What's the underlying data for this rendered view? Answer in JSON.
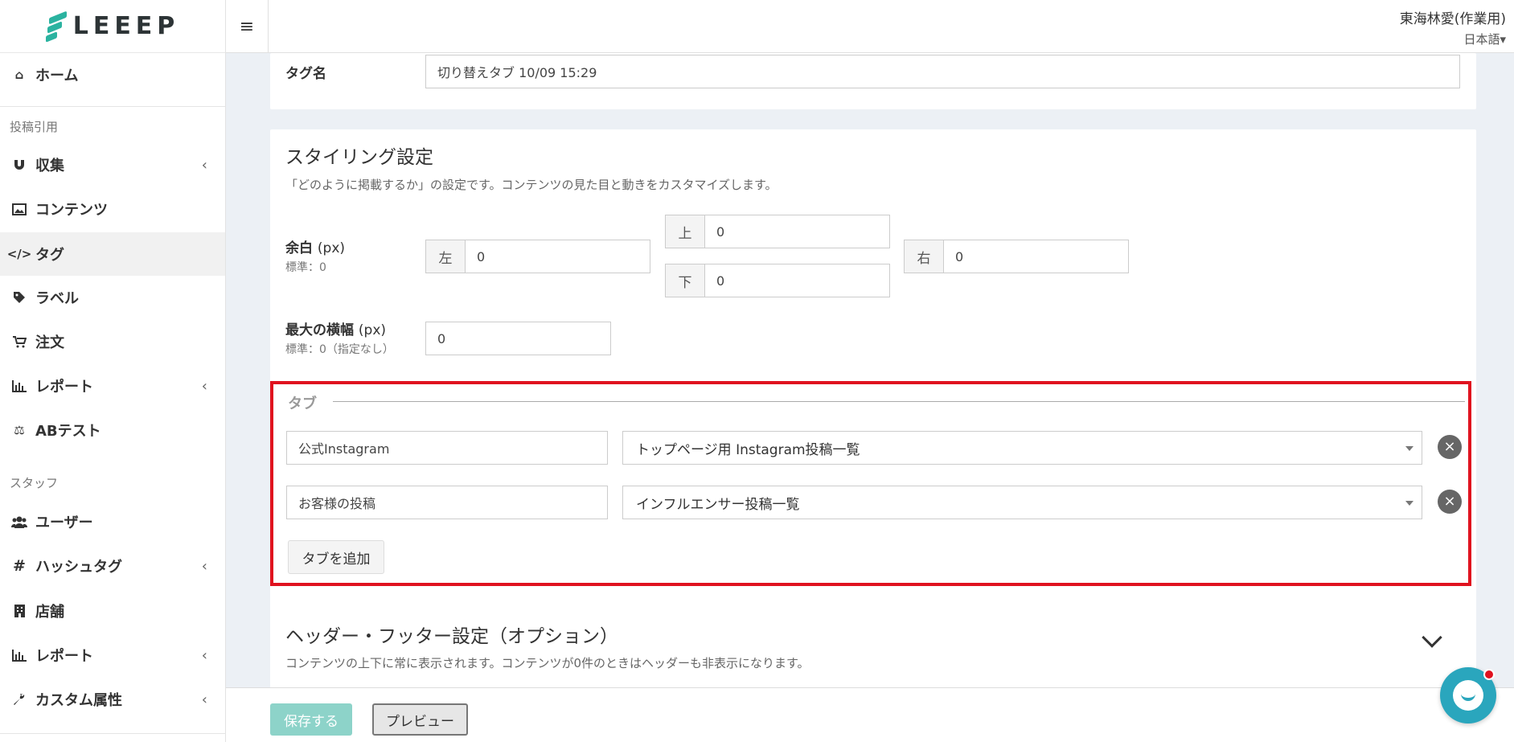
{
  "brand": {
    "name": "LEEEP"
  },
  "header": {
    "user_name": "東海林愛(作業用)",
    "language": "日本語▾"
  },
  "sidebar": {
    "items": [
      {
        "label": "ホーム",
        "icon": "home-icon"
      },
      {
        "label": "収集",
        "icon": "magnet-icon",
        "chevron": "‹"
      },
      {
        "label": "コンテンツ",
        "icon": "image-icon"
      },
      {
        "label": "タグ",
        "icon": "code-icon"
      },
      {
        "label": "ラベル",
        "icon": "tag-icon"
      },
      {
        "label": "注文",
        "icon": "cart-icon"
      },
      {
        "label": "レポート",
        "icon": "bar-chart-icon",
        "chevron": "‹"
      },
      {
        "label": "ABテスト",
        "icon": "balance-scale-icon"
      },
      {
        "label": "ユーザー",
        "icon": "users-icon"
      },
      {
        "label": "ハッシュタグ",
        "icon": "hashtag-icon",
        "chevron": "‹"
      },
      {
        "label": "店舗",
        "icon": "building-icon"
      },
      {
        "label": "レポート",
        "icon": "bar-chart-icon",
        "chevron": "‹"
      },
      {
        "label": "カスタム属性",
        "icon": "wrench-icon",
        "chevron": "‹"
      }
    ],
    "sections": {
      "posts": "投稿引用",
      "staff": "スタッフ"
    }
  },
  "tag_name": {
    "label": "タグ名",
    "value": "切り替えタブ 10/09 15:29"
  },
  "styling": {
    "title": "スタイリング設定",
    "description": "「どのように掲載するか」の設定です。コンテンツの見た目と動きをカスタマイズします。",
    "margin": {
      "label": "余白",
      "unit": "(px)",
      "standard": "標準：0",
      "left_label": "左",
      "left_value": "0",
      "top_label": "上",
      "top_value": "0",
      "bottom_label": "下",
      "bottom_value": "0",
      "right_label": "右",
      "right_value": "0"
    },
    "max_width": {
      "label": "最大の横幅",
      "unit": "(px)",
      "standard": "標準：0（指定なし）",
      "value": "0"
    }
  },
  "tabs": {
    "legend": "タブ",
    "rows": [
      {
        "name": "公式Instagram",
        "content": "トップページ用 Instagram投稿一覧"
      },
      {
        "name": "お客様の投稿",
        "content": "インフルエンサー投稿一覧"
      }
    ],
    "add_label": "タブを追加"
  },
  "header_footer": {
    "title": "ヘッダー・フッター設定（オプション）",
    "description": "コンテンツの上下に常に表示されます。コンテンツが0件のときはヘッダーも非表示になります。"
  },
  "actions": {
    "save": "保存する",
    "preview": "プレビュー"
  }
}
